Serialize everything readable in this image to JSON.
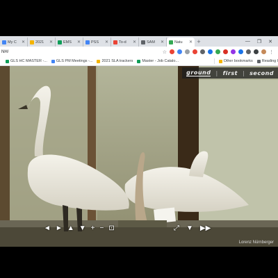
{
  "browser": {
    "tabs": [
      {
        "label": "My C",
        "color": "#4285f4",
        "active": false
      },
      {
        "label": "2021",
        "color": "#f4b400",
        "active": false
      },
      {
        "label": "EMS",
        "color": "#0f9d58",
        "active": false
      },
      {
        "label": "PSS",
        "color": "#4285f4",
        "active": false
      },
      {
        "label": "To-d",
        "color": "#ea4335",
        "active": false
      },
      {
        "label": "SAM",
        "color": "#5f6368",
        "active": false
      },
      {
        "label": "Natu",
        "color": "#34a853",
        "active": true
      }
    ],
    "new_tab": "+",
    "window_controls": {
      "minimize": "—",
      "maximize": "❐",
      "close": "✕"
    },
    "url": "NH/",
    "bookmarks": [
      {
        "label": "GLS HC MASTER -...",
        "color": "#0f9d58"
      },
      {
        "label": "GLS PM Meetings -...",
        "color": "#4285f4"
      },
      {
        "label": "2021 SLA trackers",
        "color": "#f4b400"
      },
      {
        "label": "Master - Job Catalo...",
        "color": "#0f9d58"
      }
    ],
    "bookmarks_right": [
      {
        "label": "Other bookmarks",
        "color": "#f4b400"
      },
      {
        "label": "Reading l",
        "color": "#5f6368"
      }
    ]
  },
  "tour": {
    "floors": [
      "ground",
      "first",
      "second"
    ],
    "current_floor": "ground",
    "floor_sep": "|",
    "controls_left": [
      {
        "name": "pan-left-icon",
        "glyph": "◄"
      },
      {
        "name": "pan-right-icon",
        "glyph": "►"
      },
      {
        "name": "tilt-up-icon",
        "glyph": "▲"
      },
      {
        "name": "tilt-down-icon",
        "glyph": "▼"
      },
      {
        "name": "zoom-in-icon",
        "glyph": "+"
      },
      {
        "name": "zoom-out-icon",
        "glyph": "−"
      },
      {
        "name": "vr-headset-icon",
        "glyph": "⊡"
      }
    ],
    "controls_right": [
      {
        "name": "fullscreen-icon",
        "glyph": "⤢"
      },
      {
        "name": "floor-dropdown-icon",
        "glyph": "▼"
      },
      {
        "name": "autoplay-icon",
        "glyph": "▶▶"
      }
    ],
    "credit": "Lorenz Nürnberger"
  }
}
